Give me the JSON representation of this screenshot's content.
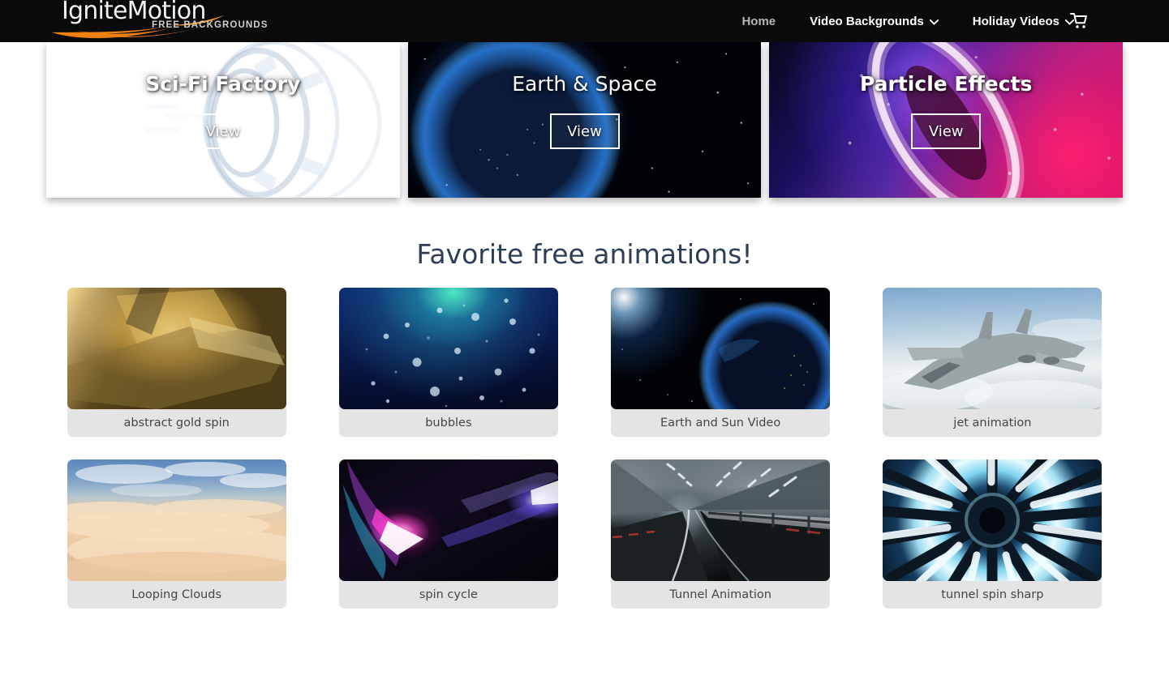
{
  "header": {
    "logo": {
      "name": "IgniteMotion",
      "tagline": "FREE BACKGROUNDS"
    },
    "nav": [
      {
        "label": "Home",
        "has_dropdown": false,
        "state": "dim"
      },
      {
        "label": "Video Backgrounds",
        "has_dropdown": true,
        "state": "normal"
      },
      {
        "label": "Holiday Videos",
        "has_dropdown": true,
        "state": "normal"
      }
    ],
    "cart_icon": "shopping-cart-icon"
  },
  "hero": {
    "cards": [
      {
        "title": "Sci-Fi Factory",
        "button": "View",
        "title_weight": "bold",
        "art": "sci-fi-factory"
      },
      {
        "title": "Earth & Space",
        "button": "View",
        "title_weight": "light",
        "art": "earth-and-space"
      },
      {
        "title": "Particle Effects",
        "button": "View",
        "title_weight": "bold",
        "art": "particle-effects"
      }
    ]
  },
  "section": {
    "heading": "Favorite free animations!",
    "heading_color": "#2d3e57"
  },
  "gallery": {
    "items": [
      {
        "caption": "abstract gold spin",
        "art": "abstract-gold-spin"
      },
      {
        "caption": "bubbles",
        "art": "bubbles"
      },
      {
        "caption": "Earth and Sun Video",
        "art": "earth-and-sun"
      },
      {
        "caption": "jet animation",
        "art": "jet"
      },
      {
        "caption": "Looping Clouds",
        "art": "clouds"
      },
      {
        "caption": "spin cycle",
        "art": "spin-cycle"
      },
      {
        "caption": "Tunnel Animation",
        "art": "tunnel"
      },
      {
        "caption": "tunnel spin sharp",
        "art": "tunnel-spin-sharp"
      }
    ]
  },
  "colors": {
    "header_bg": "#0a0a0a",
    "logo_accent": "#f08010",
    "page_bg": "#ffffff",
    "caption_bg": "#e4e4e4",
    "caption_text": "#454545"
  }
}
